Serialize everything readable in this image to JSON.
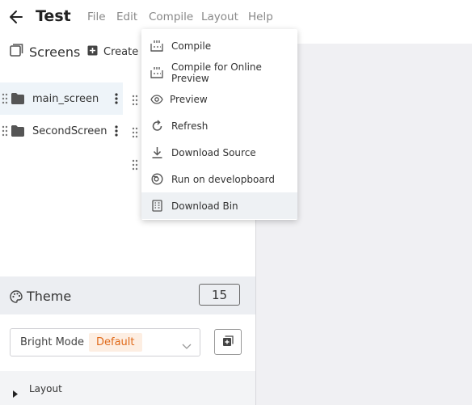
{
  "header": {
    "title": "Test",
    "menu": [
      "File",
      "Edit",
      "Compile",
      "Layout",
      "Help"
    ]
  },
  "screens": {
    "label": "Screens",
    "create_label": "Create S",
    "items": [
      {
        "name": "main_screen",
        "active": true
      },
      {
        "name": "SecondScreen",
        "active": false
      }
    ]
  },
  "compile_menu": {
    "items": [
      {
        "label": "Compile",
        "icon": "compile-icon"
      },
      {
        "label": "Compile for Online Preview",
        "icon": "compile-online-icon"
      },
      {
        "label": "Preview",
        "icon": "eye-icon"
      },
      {
        "label": "Refresh",
        "icon": "refresh-icon"
      },
      {
        "label": "Download Source",
        "icon": "download-icon"
      },
      {
        "label": "Run on developboard",
        "icon": "board-icon"
      },
      {
        "label": "Download Bin",
        "icon": "bin-icon",
        "highlighted": true
      }
    ]
  },
  "theme": {
    "label": "Theme",
    "count": "15",
    "mode": "Bright Mode",
    "badge": "Default"
  },
  "layout_section": {
    "label": "Layout"
  },
  "colors": {
    "accent_badge": "#e06a1a",
    "badge_bg": "#fdeee2",
    "active_row": "#eef4f9",
    "canvas_bg": "#f0f0f3"
  }
}
